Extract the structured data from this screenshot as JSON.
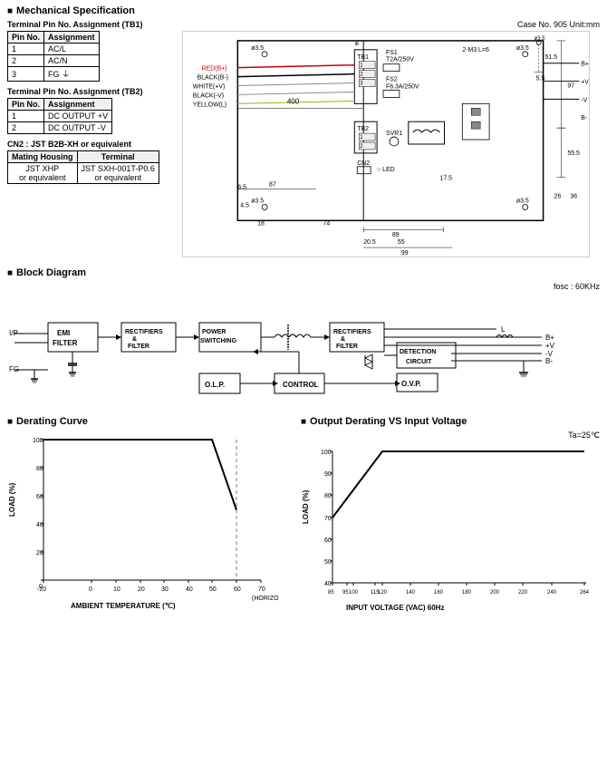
{
  "header": {
    "title": "Mechanical Specification",
    "case_info": "Case No. 905   Unit:mm"
  },
  "tb1": {
    "title": "Terminal Pin No. Assignment (TB1)",
    "headers": [
      "Pin No.",
      "Assignment"
    ],
    "rows": [
      [
        "1",
        "AC/L"
      ],
      [
        "2",
        "AC/N"
      ],
      [
        "3",
        "FG ⏚"
      ]
    ]
  },
  "tb2": {
    "title": "Terminal Pin No. Assignment (TB2)",
    "headers": [
      "Pin No.",
      "Assignment"
    ],
    "rows": [
      [
        "1",
        "DC OUTPUT +V"
      ],
      [
        "2",
        "DC OUTPUT -V"
      ]
    ]
  },
  "cn2": {
    "title": "CN2 : JST B2B-XH or equivalent",
    "headers": [
      "Mating Housing",
      "Terminal"
    ],
    "rows": [
      [
        "JST XHP",
        "JST SXH-001T-P0.6"
      ],
      [
        "or equivalent",
        "or equivalent"
      ]
    ]
  },
  "block_diagram": {
    "title": "Block Diagram",
    "fosc": "fosc : 60KHz",
    "blocks": [
      "EMI FILTER",
      "RECTIFIERS & FILTER",
      "POWER SWITCHING",
      "RECTIFIERS & FILTER",
      "DETECTION CIRCUIT",
      "CONTROL",
      "O.L.P.",
      "O.V.P."
    ],
    "outputs": [
      "L",
      "+V",
      "-V",
      "B-"
    ],
    "inputs": [
      "I/P",
      "FG"
    ]
  },
  "derating_curve": {
    "title": "Derating Curve",
    "x_label": "AMBIENT TEMPERATURE (℃)",
    "y_label": "LOAD (%)",
    "x_min": -20,
    "x_max": 70,
    "y_min": 0,
    "y_max": 100,
    "x_ticks": [
      "-20",
      "0",
      "10",
      "20",
      "30",
      "40",
      "50",
      "60",
      "70"
    ],
    "y_ticks": [
      "0",
      "20",
      "40",
      "60",
      "80",
      "100"
    ],
    "x_note": "(HORIZONTAL)",
    "curve_points": "flat at 100 from -20 to 50, then drops to ~50 at 60, note 70 on axis"
  },
  "output_derating": {
    "title": "Output Derating VS Input Voltage",
    "ta": "Ta=25℃",
    "x_label": "INPUT VOLTAGE (VAC) 60Hz",
    "y_label": "LOAD (%)",
    "x_min": 85,
    "x_max": 264,
    "y_min": 30,
    "y_max": 100,
    "x_ticks": [
      "85",
      "95",
      "100",
      "115",
      "120",
      "140",
      "160",
      "180",
      "200",
      "220",
      "240",
      "264"
    ],
    "y_ticks": [
      "40",
      "50",
      "60",
      "70",
      "80",
      "90",
      "100"
    ]
  }
}
